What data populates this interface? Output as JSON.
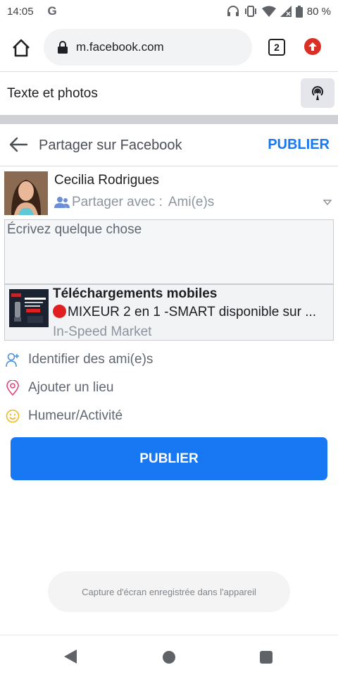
{
  "status_bar": {
    "time": "14:05",
    "app_letter": "G",
    "battery": "80 %"
  },
  "browser": {
    "url": "m.facebook.com",
    "tab_count": "2"
  },
  "composer_mode": {
    "label": "Texte et photos"
  },
  "share_header": {
    "title": "Partager sur Facebook",
    "publish_label": "PUBLIER"
  },
  "author": {
    "name": "Cecilia Rodrigues",
    "share_with_label": "Partager avec :",
    "audience": "Ami(e)s"
  },
  "composer": {
    "placeholder": "Écrivez quelque chose"
  },
  "link_preview": {
    "title": "Téléchargements mobiles",
    "description": "MIXEUR 2 en 1 -SMART disponible sur ...",
    "source": "In-Speed Market"
  },
  "options": [
    {
      "label": "Identifier des ami(e)s",
      "icon": "tag-friends-icon"
    },
    {
      "label": "Ajouter un lieu",
      "icon": "location-pin-icon"
    },
    {
      "label": "Humeur/Activité",
      "icon": "smiley-icon"
    }
  ],
  "publish_button": {
    "label": "PUBLIER"
  },
  "toast": {
    "message": "Capture d'écran enregistrée dans l'appareil"
  },
  "colors": {
    "brand_blue": "#1877f2",
    "update_red": "#d93025"
  }
}
